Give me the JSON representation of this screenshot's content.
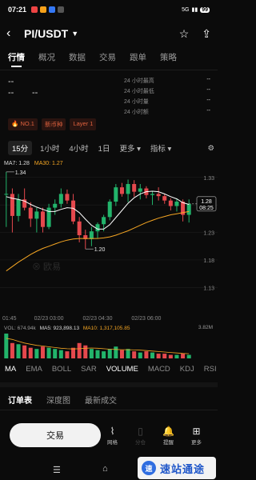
{
  "status_bar": {
    "time": "07:21",
    "network": "5G",
    "battery": "99"
  },
  "header": {
    "title": "PI/USDT"
  },
  "tabs": [
    "行情",
    "概况",
    "数据",
    "交易",
    "跟单",
    "策略"
  ],
  "stats": {
    "last_price": "--",
    "sub_left": "--",
    "sub_right": "--",
    "rows": [
      {
        "label": "24 小时最高",
        "value": "--"
      },
      {
        "label": "24 小时最低",
        "value": "--"
      },
      {
        "label": "24 小时量",
        "value": "--"
      },
      {
        "label": "24 小时额",
        "value": "--"
      }
    ]
  },
  "tags": [
    "NO.1",
    "新币种",
    "Layer 1"
  ],
  "intervals": {
    "items": [
      "15分",
      "1小时",
      "4小时",
      "1日"
    ],
    "more": "更多",
    "indicator": "指标"
  },
  "ma_legend": {
    "ma7": "MA7: 1.28",
    "ma30": "MA30: 1.27"
  },
  "chart_data": {
    "type": "candlestick",
    "x_ticks": [
      "01:45",
      "02/23 03:00",
      "02/23 04:30",
      "02/23 06:00"
    ],
    "y_ticks": [
      "1.33",
      "1.28",
      "1.23",
      "1.18",
      "1.13"
    ],
    "price_tag": {
      "price": "1.28",
      "countdown": "08:25"
    },
    "annotations": {
      "high": "1.34",
      "low": "1.20"
    },
    "candles": [
      {
        "o": 1.3,
        "h": 1.34,
        "l": 1.24,
        "c": 1.3
      },
      {
        "o": 1.3,
        "h": 1.31,
        "l": 1.23,
        "c": 1.26
      },
      {
        "o": 1.26,
        "h": 1.3,
        "l": 1.25,
        "c": 1.29
      },
      {
        "o": 1.29,
        "h": 1.31,
        "l": 1.27,
        "c": 1.275
      },
      {
        "o": 1.275,
        "h": 1.285,
        "l": 1.24,
        "c": 1.255
      },
      {
        "o": 1.255,
        "h": 1.275,
        "l": 1.23,
        "c": 1.268
      },
      {
        "o": 1.268,
        "h": 1.275,
        "l": 1.23,
        "c": 1.24
      },
      {
        "o": 1.24,
        "h": 1.282,
        "l": 1.236,
        "c": 1.275
      },
      {
        "o": 1.275,
        "h": 1.29,
        "l": 1.262,
        "c": 1.282
      },
      {
        "o": 1.282,
        "h": 1.31,
        "l": 1.275,
        "c": 1.3
      },
      {
        "o": 1.3,
        "h": 1.308,
        "l": 1.282,
        "c": 1.288
      },
      {
        "o": 1.288,
        "h": 1.3,
        "l": 1.245,
        "c": 1.25
      },
      {
        "o": 1.25,
        "h": 1.258,
        "l": 1.212,
        "c": 1.225
      },
      {
        "o": 1.225,
        "h": 1.235,
        "l": 1.2,
        "c": 1.218
      },
      {
        "o": 1.218,
        "h": 1.24,
        "l": 1.205,
        "c": 1.232
      },
      {
        "o": 1.232,
        "h": 1.248,
        "l": 1.22,
        "c": 1.245
      },
      {
        "o": 1.245,
        "h": 1.262,
        "l": 1.232,
        "c": 1.258
      },
      {
        "o": 1.258,
        "h": 1.29,
        "l": 1.252,
        "c": 1.286
      },
      {
        "o": 1.286,
        "h": 1.318,
        "l": 1.278,
        "c": 1.312
      },
      {
        "o": 1.312,
        "h": 1.32,
        "l": 1.295,
        "c": 1.3
      },
      {
        "o": 1.3,
        "h": 1.326,
        "l": 1.285,
        "c": 1.318
      },
      {
        "o": 1.318,
        "h": 1.325,
        "l": 1.295,
        "c": 1.304
      },
      {
        "o": 1.304,
        "h": 1.318,
        "l": 1.29,
        "c": 1.31
      },
      {
        "o": 1.31,
        "h": 1.314,
        "l": 1.292,
        "c": 1.298
      },
      {
        "o": 1.298,
        "h": 1.305,
        "l": 1.28,
        "c": 1.3
      },
      {
        "o": 1.3,
        "h": 1.312,
        "l": 1.288,
        "c": 1.296
      },
      {
        "o": 1.296,
        "h": 1.3,
        "l": 1.282,
        "c": 1.288
      },
      {
        "o": 1.288,
        "h": 1.292,
        "l": 1.27,
        "c": 1.278
      },
      {
        "o": 1.278,
        "h": 1.292,
        "l": 1.268,
        "c": 1.286
      },
      {
        "o": 1.286,
        "h": 1.29,
        "l": 1.25,
        "c": 1.262
      },
      {
        "o": 1.262,
        "h": 1.29,
        "l": 1.248,
        "c": 1.282
      }
    ],
    "ma7": [
      1.295,
      1.292,
      1.29,
      1.287,
      1.281,
      1.276,
      1.272,
      1.268,
      1.268,
      1.272,
      1.275,
      1.274,
      1.266,
      1.254,
      1.243,
      1.236,
      1.236,
      1.244,
      1.257,
      1.27,
      1.283,
      1.293,
      1.3,
      1.304,
      1.305,
      1.304,
      1.3,
      1.295,
      1.291,
      1.284,
      1.281
    ],
    "ma30": [
      1.16,
      1.168,
      1.176,
      1.183,
      1.19,
      1.196,
      1.201,
      1.205,
      1.209,
      1.213,
      1.216,
      1.218,
      1.219,
      1.219,
      1.219,
      1.219,
      1.22,
      1.222,
      1.225,
      1.229,
      1.233,
      1.238,
      1.243,
      1.248,
      1.252,
      1.256,
      1.259,
      1.262,
      1.264,
      1.266,
      1.268
    ]
  },
  "volume": {
    "label": "VOL: 674.94k",
    "ma5": "MA5: 923,898.13",
    "ma10": "MA10: 1,317,105.85",
    "max_label": "3.82M",
    "bars": [
      2.1,
      1.3,
      1.2,
      1.1,
      0.9,
      0.8,
      1.0,
      0.9,
      0.8,
      0.7,
      0.6,
      0.9,
      1.3,
      1.1,
      0.8,
      0.7,
      0.6,
      0.8,
      1.0,
      0.7,
      0.8,
      0.6,
      0.5,
      0.6,
      0.5,
      0.4,
      0.4,
      0.3,
      0.3,
      0.4,
      0.3
    ],
    "ma_line": [
      1.7,
      1.6,
      1.45,
      1.3,
      1.2,
      1.1,
      1.05,
      0.98,
      0.92,
      0.86,
      0.82,
      0.8,
      0.82,
      0.86,
      0.88,
      0.86,
      0.82,
      0.78,
      0.76,
      0.74,
      0.74,
      0.72,
      0.7,
      0.66,
      0.62,
      0.58,
      0.54,
      0.5,
      0.46,
      0.42,
      0.4
    ]
  },
  "indicator_tabs": [
    "MA",
    "EMA",
    "BOLL",
    "SAR",
    "VOLUME",
    "MACD",
    "KDJ",
    "RSI"
  ],
  "book_tabs": [
    "订单表",
    "深度图",
    "最新成交"
  ],
  "bottom_bar": {
    "trade": "交易",
    "items": [
      "网格",
      "分仓",
      "提醒",
      "更多"
    ]
  },
  "promo": {
    "logo": "速",
    "text": "速站通途"
  },
  "colors": {
    "up": "#22b46b",
    "down": "#e5484d",
    "ma7": "#ffffff",
    "ma30": "#f5a623",
    "accent": "#e0623e"
  }
}
